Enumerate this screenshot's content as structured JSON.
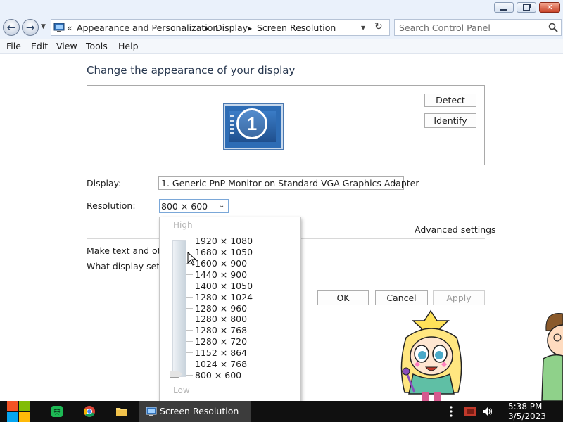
{
  "window": {
    "controls": {
      "minimize_icon": "minimize-icon",
      "maximize_icon": "restore-icon",
      "close_icon": "close-icon"
    }
  },
  "address": {
    "prefix": "«",
    "crumbs": [
      "Appearance and Personalization",
      "Display",
      "Screen Resolution"
    ],
    "search_placeholder": "Search Control Panel"
  },
  "menu": {
    "items": [
      "File",
      "Edit",
      "View",
      "Tools",
      "Help"
    ]
  },
  "main": {
    "heading": "Change the appearance of your display",
    "monitor_number": "1",
    "detect_label": "Detect",
    "identify_label": "Identify",
    "display_label": "Display:",
    "display_value": "1. Generic PnP Monitor on Standard VGA Graphics Adapter",
    "resolution_label": "Resolution:",
    "resolution_value": "800 × 600",
    "advanced_link": "Advanced settings",
    "text_link_partial": "Make text and othe",
    "display_settings_partial": "What display settin",
    "ok_label": "OK",
    "cancel_label": "Cancel",
    "apply_label": "Apply"
  },
  "resolution_dropdown": {
    "high_label": "High",
    "low_label": "Low",
    "options": [
      "1920 × 1080",
      "1680 × 1050",
      "1600 × 900",
      "1440 × 900",
      "1400 × 1050",
      "1280 × 1024",
      "1280 × 960",
      "1280 × 800",
      "1280 × 768",
      "1280 × 720",
      "1152 × 864",
      "1024 × 768",
      "800 × 600"
    ],
    "selected": "800 × 600"
  },
  "taskbar": {
    "active_window": "Screen Resolution",
    "time": "5:38 PM",
    "date": "3/5/2023"
  },
  "colors": {
    "titlebar_bg": "#eaf1fb",
    "taskbar_bg": "#101010",
    "start_orange": "#f35325",
    "start_green": "#81bc06",
    "start_blue": "#05a6f0",
    "start_yellow": "#ffba08"
  }
}
